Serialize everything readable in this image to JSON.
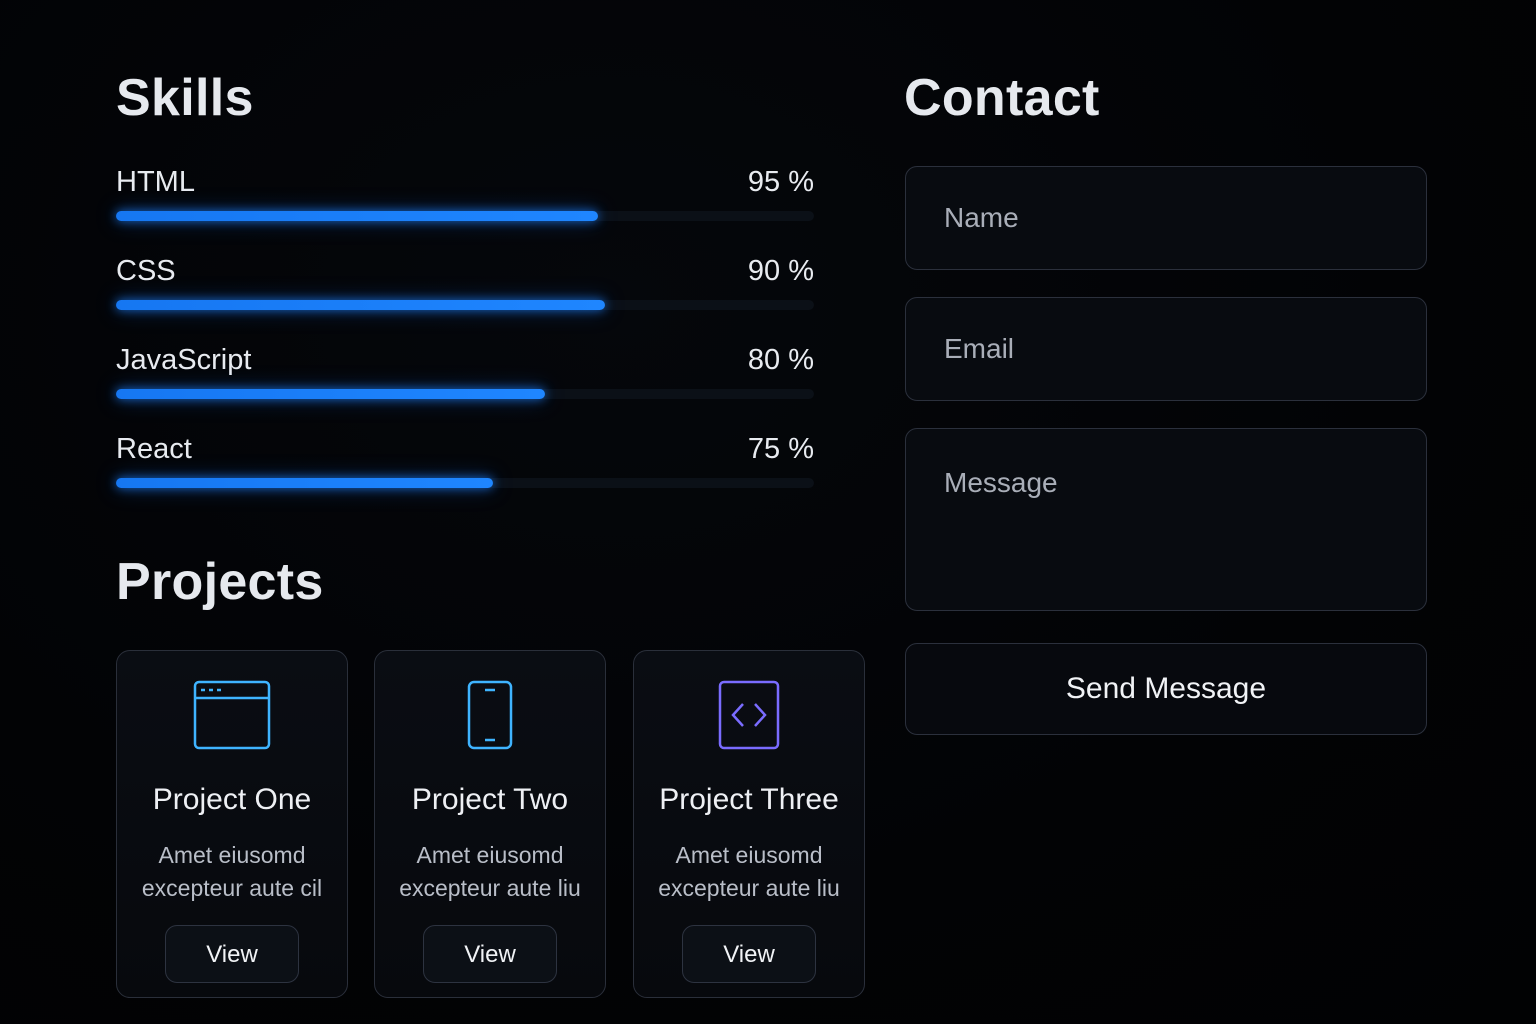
{
  "skills": {
    "title": "Skills",
    "accent_color": "#1f82ff",
    "items": [
      {
        "name": "HTML",
        "percent_label": "95 %",
        "fill": 0.69
      },
      {
        "name": "CSS",
        "percent_label": "90 %",
        "fill": 0.7
      },
      {
        "name": "JavaScript",
        "percent_label": "80 %",
        "fill": 0.615
      },
      {
        "name": "React",
        "percent_label": "75 %",
        "fill": 0.54
      }
    ]
  },
  "projects": {
    "title": "Projects",
    "cards": [
      {
        "icon": "browser-window-icon",
        "title": "Project One",
        "description": "Amet eiusomd\nexcepteur aute cil",
        "button_label": "View",
        "icon_color": "#3fb4ff"
      },
      {
        "icon": "mobile-phone-icon",
        "title": "Project Two",
        "description": "Amet eiusomd\nexcepteur aute liu",
        "button_label": "View",
        "icon_color": "#3fb4ff"
      },
      {
        "icon": "code-brackets-icon",
        "title": "Project Three",
        "description": "Amet eiusomd\nexcepteur aute liu",
        "button_label": "View",
        "icon_color": "#7a6cff"
      }
    ]
  },
  "contact": {
    "title": "Contact",
    "name_placeholder": "Name",
    "email_placeholder": "Email",
    "message_placeholder": "Message",
    "send_label": "Send Message"
  }
}
